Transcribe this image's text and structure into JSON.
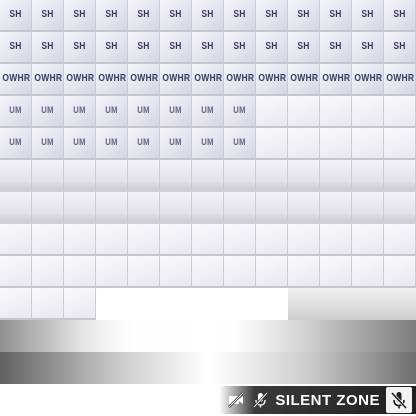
{
  "tiles": {
    "row0_text": "SH",
    "row1_text": "SH",
    "row2_text": "OWHR",
    "row3_text": "UM"
  },
  "status": {
    "label": "SILENT ZONE",
    "icons": [
      "no-video-icon",
      "mute-mic-icon",
      "muted-microphone-icon"
    ],
    "text_color": "#ffffff",
    "badge_color": "#1f1f1f"
  },
  "colors": {
    "tile_light": "#f4f5fb",
    "tile_dark": "#d3d6e2",
    "tile_text": "#35415f"
  }
}
